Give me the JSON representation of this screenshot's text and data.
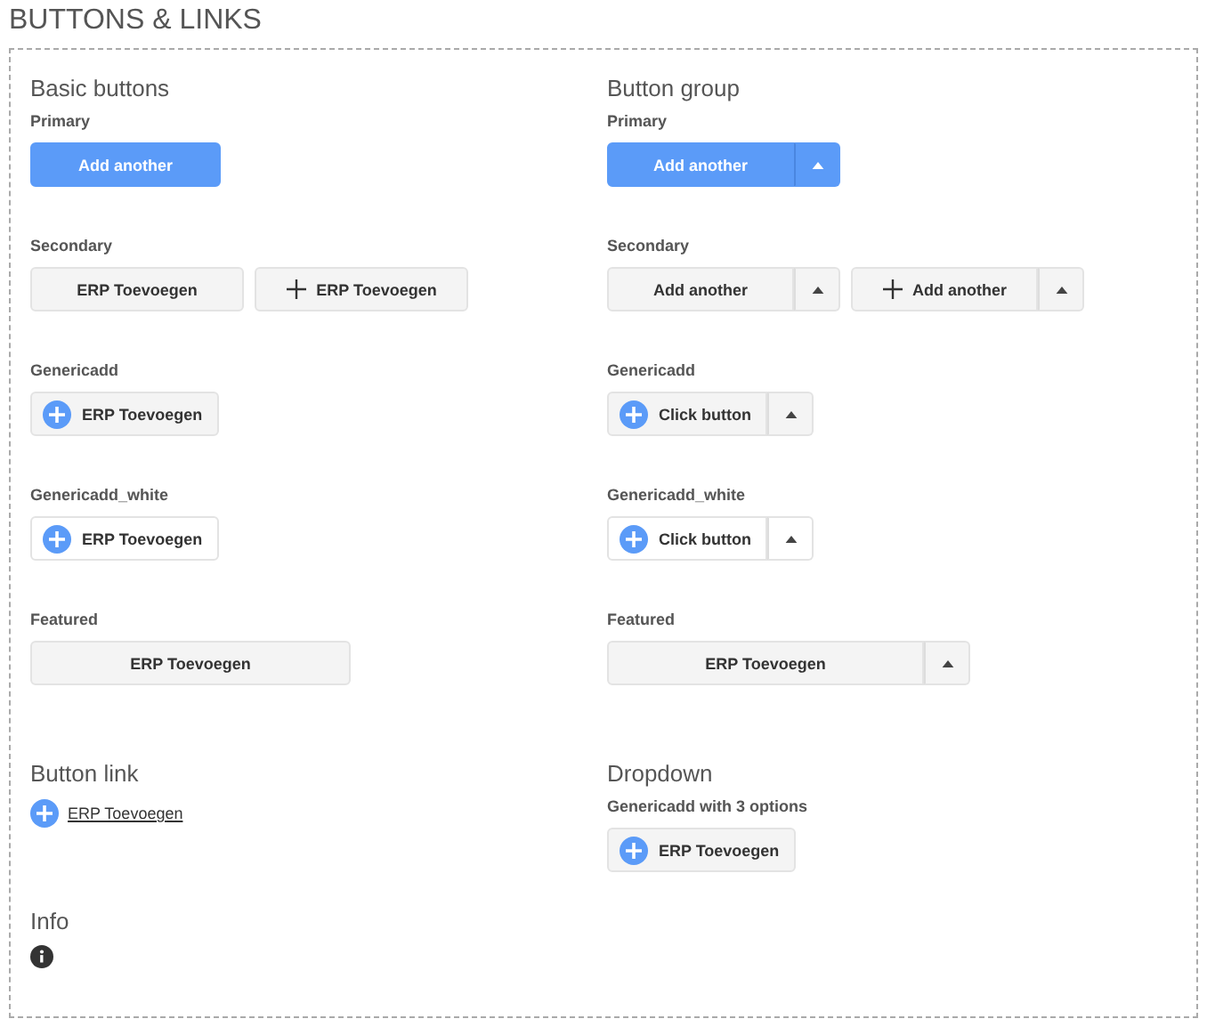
{
  "title": "BUTTONS & LINKS",
  "columns": [
    {
      "sections": [
        {
          "heading": "Basic buttons",
          "groups": [
            {
              "label": "Primary",
              "buttons": [
                {
                  "kind": "primary",
                  "label": "Add another"
                }
              ]
            },
            {
              "label": "Secondary",
              "buttons": [
                {
                  "kind": "secondary",
                  "label": "ERP Toevoegen"
                },
                {
                  "kind": "secondary_plus",
                  "label": "ERP Toevoegen"
                }
              ]
            },
            {
              "label": "Genericadd",
              "buttons": [
                {
                  "kind": "genericadd",
                  "label": "ERP Toevoegen"
                }
              ]
            },
            {
              "label": "Genericadd_white",
              "buttons": [
                {
                  "kind": "genericadd_white",
                  "label": "ERP Toevoegen"
                }
              ]
            },
            {
              "label": "Featured",
              "buttons": [
                {
                  "kind": "featured",
                  "label": "ERP Toevoegen"
                }
              ]
            }
          ]
        },
        {
          "heading": "Button link",
          "groups": [
            {
              "buttons": [
                {
                  "kind": "link",
                  "label": "ERP Toevoegen"
                }
              ]
            }
          ]
        },
        {
          "heading": "Info",
          "groups": [
            {
              "buttons": [
                {
                  "kind": "info"
                }
              ]
            }
          ]
        }
      ]
    },
    {
      "sections": [
        {
          "heading": "Button group",
          "groups": [
            {
              "label": "Primary",
              "buttons": [
                {
                  "kind": "primary",
                  "label": "Add another",
                  "split": true
                }
              ]
            },
            {
              "label": "Secondary",
              "buttons": [
                {
                  "kind": "secondary",
                  "label": "Add another",
                  "split": true
                },
                {
                  "kind": "secondary_plus",
                  "label": "Add another",
                  "split": true
                }
              ]
            },
            {
              "label": "Genericadd",
              "buttons": [
                {
                  "kind": "genericadd",
                  "label": "Click button",
                  "split": true
                }
              ]
            },
            {
              "label": "Genericadd_white",
              "buttons": [
                {
                  "kind": "genericadd_white",
                  "label": "Click button",
                  "split": true
                }
              ]
            },
            {
              "label": "Featured",
              "buttons": [
                {
                  "kind": "featured",
                  "label": "ERP Toevoegen",
                  "split": true
                }
              ]
            }
          ]
        },
        {
          "heading": "Dropdown",
          "groups": [
            {
              "label": "Genericadd with 3 options",
              "buttons": [
                {
                  "kind": "genericadd",
                  "label": "ERP Toevoegen"
                }
              ]
            }
          ]
        }
      ]
    }
  ]
}
